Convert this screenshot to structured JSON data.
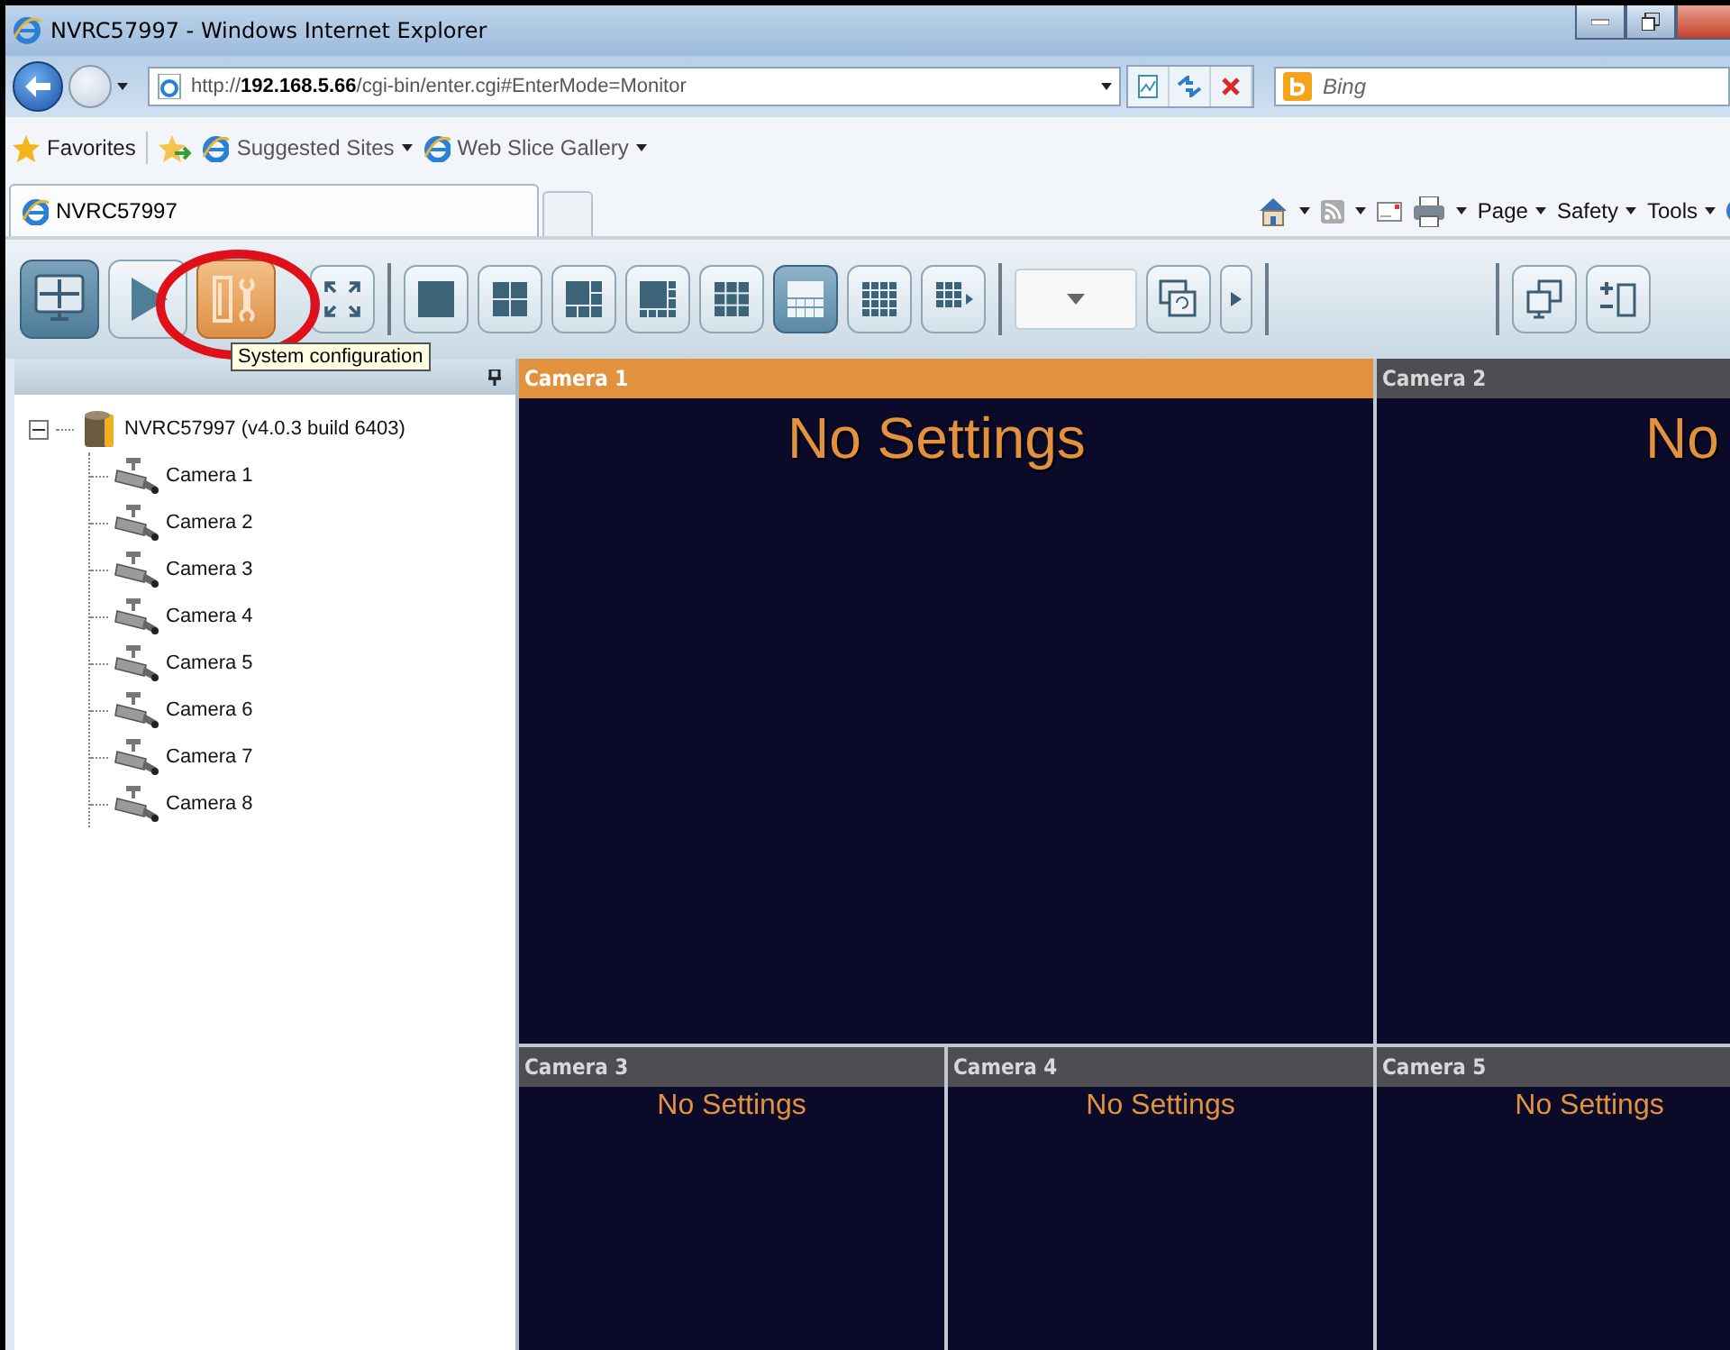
{
  "window": {
    "title": "NVRC57997 - Windows Internet Explorer"
  },
  "address_bar": {
    "value": "http://**192.168.5.66**/cgi-bin/enter.cgi#EnterMode=Monitor"
  },
  "search": {
    "placeholder": "Bing"
  },
  "favorites_bar": {
    "favorites": "Favorites",
    "links": [
      "Suggested Sites",
      "Web Slice Gallery"
    ]
  },
  "tabs": [
    {
      "label": "NVRC57997",
      "selected": true
    }
  ],
  "command_bar": {
    "menus": [
      "Page",
      "Safety",
      "Tools"
    ]
  },
  "toolbar": {
    "modes": [
      {
        "kind": "live",
        "selected": true,
        "hovered": false
      },
      {
        "kind": "playback",
        "selected": false,
        "hovered": false
      },
      {
        "kind": "config",
        "selected": false,
        "hovered": true
      }
    ],
    "layouts": [
      {
        "kind": "single",
        "selected": false
      },
      {
        "kind": "quad",
        "selected": false
      },
      {
        "kind": "six",
        "selected": false
      },
      {
        "kind": "eight",
        "selected": false
      },
      {
        "kind": "nine",
        "selected": false
      },
      {
        "kind": "thirteen",
        "selected": true
      },
      {
        "kind": "sixteen",
        "selected": false
      },
      {
        "kind": "more",
        "selected": false
      }
    ],
    "tooltip": "System configuration"
  },
  "sidebar": {
    "tree": [
      {
        "label": "NVRC57997 (v4.0.3 build 6403)",
        "expanded": true,
        "children": [
          {
            "label": "Camera 1"
          },
          {
            "label": "Camera 2"
          },
          {
            "label": "Camera 3"
          },
          {
            "label": "Camera 4"
          },
          {
            "label": "Camera 5"
          },
          {
            "label": "Camera 6"
          },
          {
            "label": "Camera 7"
          },
          {
            "label": "Camera 8"
          }
        ]
      }
    ]
  },
  "cameras": [
    {
      "title": "Camera 1",
      "message": "No Settings",
      "kind": "large",
      "selected": true
    },
    {
      "title": "Camera 2",
      "message": "No",
      "kind": "large",
      "selected": false
    },
    {
      "title": "Camera 3",
      "message": "No Settings",
      "kind": "small",
      "selected": false
    },
    {
      "title": "Camera 4",
      "message": "No Settings",
      "kind": "small",
      "selected": false
    },
    {
      "title": "Camera 5",
      "message": "No Settings",
      "kind": "small",
      "selected": false
    }
  ]
}
